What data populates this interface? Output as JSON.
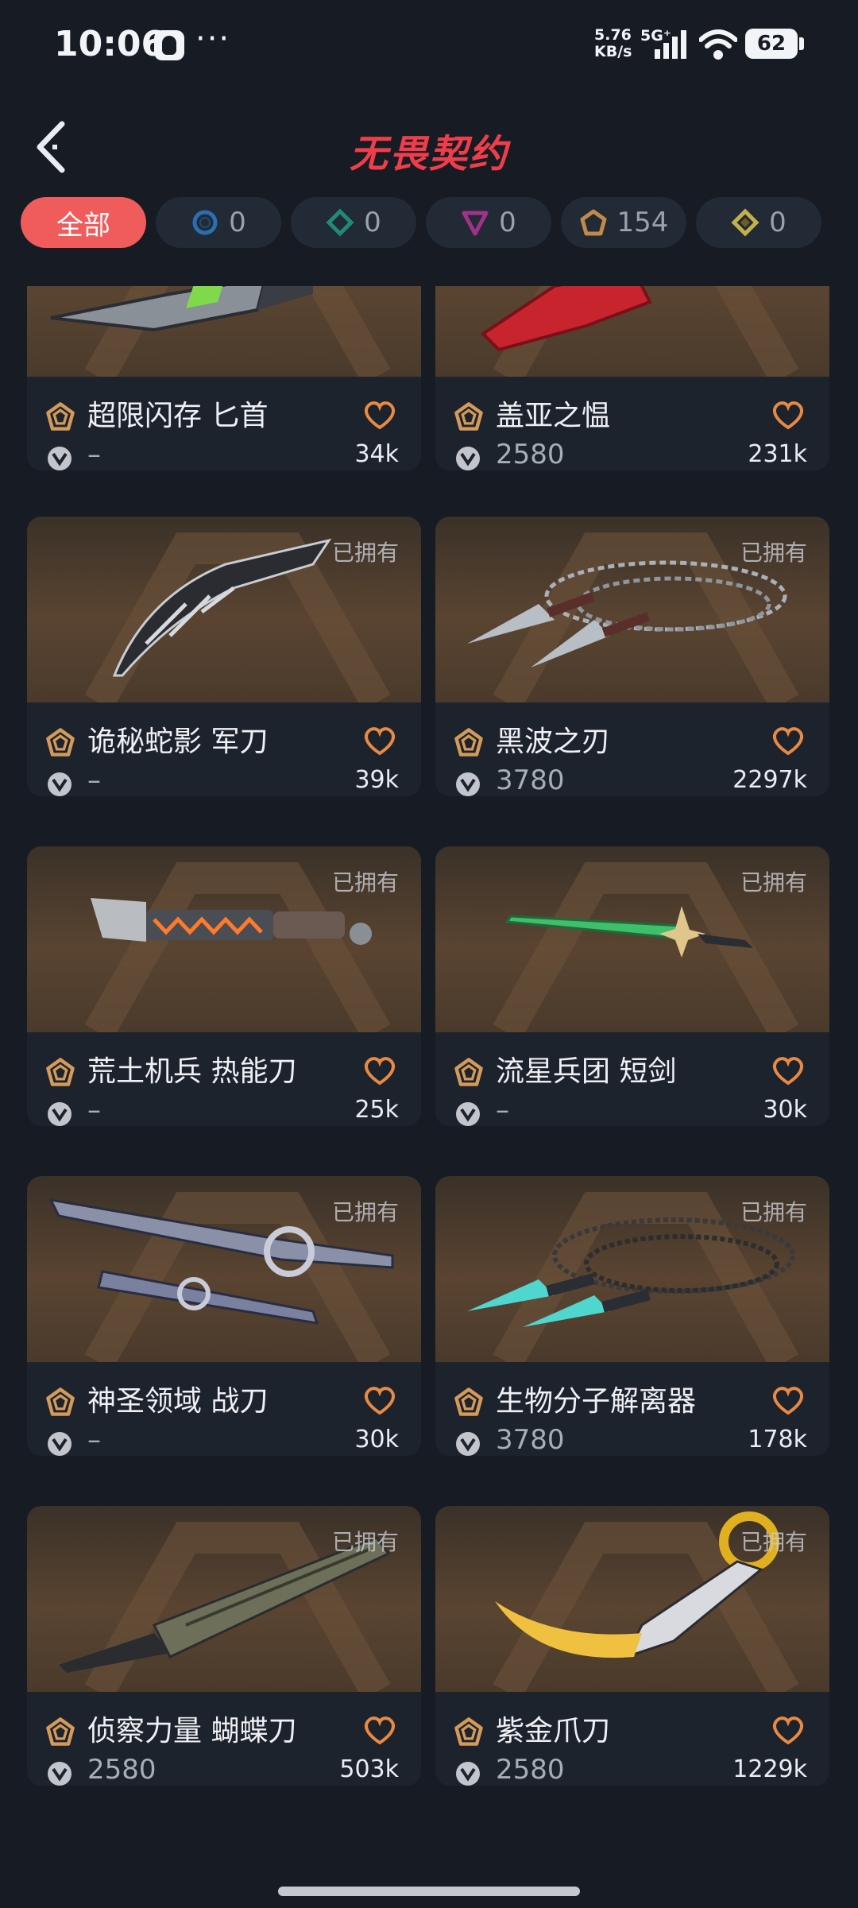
{
  "status_bar": {
    "time": "10:06",
    "dots": "···",
    "speed_value": "5.76",
    "speed_unit": "KB/s",
    "network": "5G⁺",
    "battery": "62"
  },
  "header": {
    "title": "无畏契约",
    "back_icon": "chevron-left-icon"
  },
  "filters": [
    {
      "label": "全部",
      "active": true
    },
    {
      "icon": "circle-tier-icon",
      "count": "0",
      "color": "#2c6fb0"
    },
    {
      "icon": "diamond-tier-icon",
      "count": "0",
      "color": "#1f8a7a"
    },
    {
      "icon": "triangle-tier-icon",
      "count": "0",
      "color": "#a0328c"
    },
    {
      "icon": "pentagon-tier-icon",
      "count": "154",
      "color": "#c08a4a"
    },
    {
      "icon": "rhombus-tier-icon",
      "count": "0",
      "color": "#c3b04a"
    }
  ],
  "items": [
    {
      "name": "超限闪存 匕首",
      "price": "–",
      "likes": "34k",
      "owned": ""
    },
    {
      "name": "盖亚之愠",
      "price": "2580",
      "likes": "231k",
      "owned": ""
    },
    {
      "name": "诡秘蛇影 军刀",
      "price": "–",
      "likes": "39k",
      "owned": "已拥有"
    },
    {
      "name": "黑波之刃",
      "price": "3780",
      "likes": "2297k",
      "owned": "已拥有"
    },
    {
      "name": "荒土机兵 热能刀",
      "price": "–",
      "likes": "25k",
      "owned": "已拥有"
    },
    {
      "name": "流星兵团 短剑",
      "price": "–",
      "likes": "30k",
      "owned": "已拥有"
    },
    {
      "name": "神圣领域 战刀",
      "price": "–",
      "likes": "30k",
      "owned": "已拥有"
    },
    {
      "name": "生物分子解离器",
      "price": "3780",
      "likes": "178k",
      "owned": "已拥有"
    },
    {
      "name": "侦察力量 蝴蝶刀",
      "price": "2580",
      "likes": "503k",
      "owned": "已拥有"
    },
    {
      "name": "紫金爪刀",
      "price": "2580",
      "likes": "1229k",
      "owned": "已拥有"
    }
  ],
  "colors": {
    "background": "#161b24",
    "accent": "#f05b5b",
    "title": "#ef3e4a",
    "tier_premium": "#c08a4a"
  }
}
